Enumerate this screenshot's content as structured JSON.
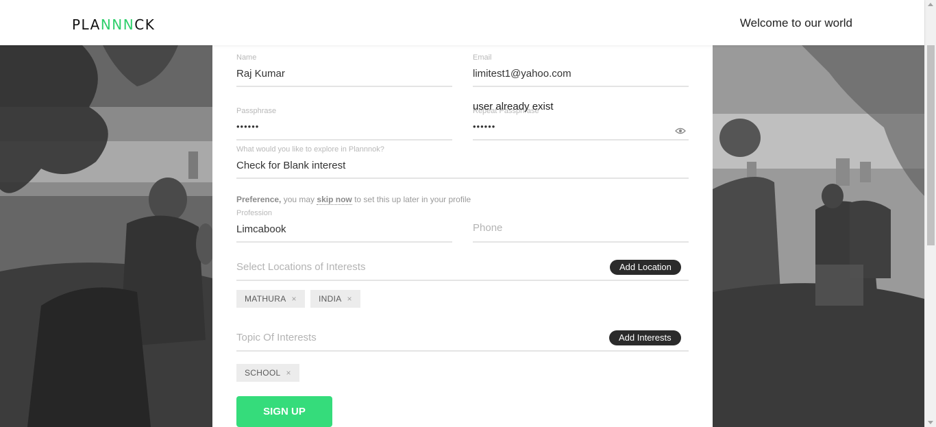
{
  "header": {
    "logo_prefix": "PLA",
    "logo_accent": "NNN",
    "logo_suffix": "CK",
    "welcome": "Welcome to our world"
  },
  "form": {
    "name": {
      "label": "Name",
      "value": "Raj Kumar"
    },
    "email": {
      "label": "Email",
      "value": "limitest1@yahoo.com"
    },
    "passphrase": {
      "label": "Passphrase",
      "value": "••••••"
    },
    "repeat_passphrase": {
      "label": "Repeat Passphrase",
      "value": "••••••",
      "error": "user already exist"
    },
    "explore": {
      "label": "What would you like to explore in Plannnok?",
      "value": "Check for Blank interest"
    },
    "preference_note": {
      "bold": "Preference,",
      "pre": " you may ",
      "link": "skip now",
      "post": " to set this up later in your profile"
    },
    "profession": {
      "label": "Profession",
      "value": "Limcabook"
    },
    "phone": {
      "placeholder": "Phone"
    },
    "locations": {
      "placeholder": "Select Locations of Interests",
      "button": "Add Location",
      "chips": [
        "MATHURA",
        "INDIA"
      ]
    },
    "topics": {
      "placeholder": "Topic Of Interests",
      "button": "Add Interests",
      "chips": [
        "SCHOOL"
      ]
    },
    "chip_remove": "×",
    "signup": "SIGN UP"
  },
  "colors": {
    "accent": "#35dc7b",
    "dark_button": "#2b2b2b"
  }
}
